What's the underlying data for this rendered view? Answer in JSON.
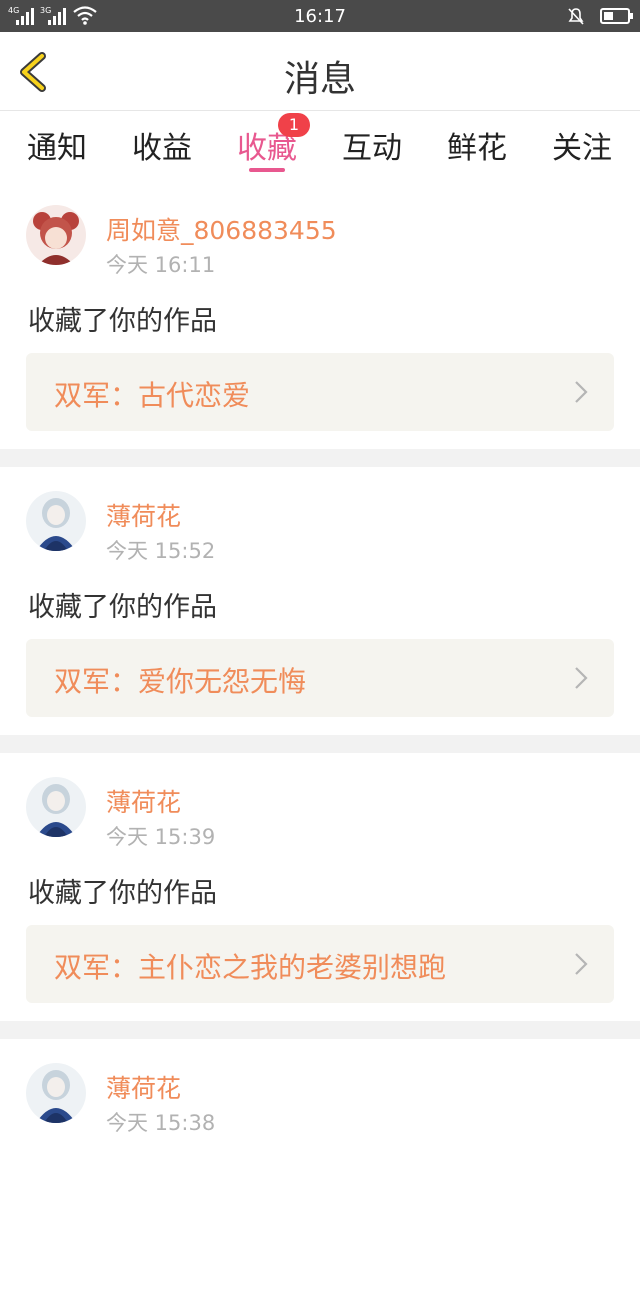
{
  "status_bar": {
    "net1": "4G",
    "net2": "3G",
    "time": "16:17"
  },
  "header": {
    "title": "消息"
  },
  "tabs": [
    {
      "label": "通知"
    },
    {
      "label": "收益"
    },
    {
      "label": "收藏",
      "badge": "1"
    },
    {
      "label": "互动"
    },
    {
      "label": "鲜花"
    },
    {
      "label": "关注"
    }
  ],
  "active_tab": "收藏",
  "colors": {
    "accent": "#e8588f",
    "name": "#f08c5a",
    "badge": "#f04149"
  },
  "messages": [
    {
      "user": "周如意_806883455",
      "time": "今天 16:11",
      "action": "收藏了你的作品",
      "work": "双军：古代恋爱",
      "avatar_icon": "user-avatar-red-hair"
    },
    {
      "user": "薄荷花",
      "time": "今天 15:52",
      "action": "收藏了你的作品",
      "work": "双军：爱你无怨无悔",
      "avatar_icon": "user-avatar-blue-dress"
    },
    {
      "user": "薄荷花",
      "time": "今天 15:39",
      "action": "收藏了你的作品",
      "work": "双军：主仆恋之我的老婆别想跑",
      "avatar_icon": "user-avatar-blue-dress"
    },
    {
      "user": "薄荷花",
      "time": "今天 15:38",
      "action": "",
      "work": "",
      "avatar_icon": "user-avatar-blue-dress"
    }
  ]
}
